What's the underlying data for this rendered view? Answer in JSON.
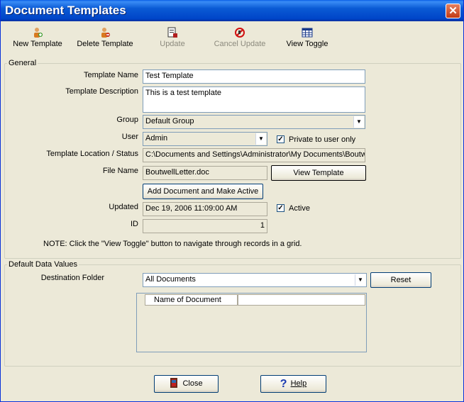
{
  "window": {
    "title": "Document Templates",
    "close_glyph": "✕"
  },
  "toolbar": [
    {
      "label": "New Template",
      "icon": "new-template-icon",
      "enabled": true
    },
    {
      "label": "Delete Template",
      "icon": "delete-template-icon",
      "enabled": true
    },
    {
      "label": "Update",
      "icon": "update-icon",
      "enabled": false
    },
    {
      "label": "Cancel Update",
      "icon": "cancel-update-icon",
      "enabled": false
    },
    {
      "label": "View Toggle",
      "icon": "view-toggle-icon",
      "enabled": true
    }
  ],
  "general": {
    "legend": "General",
    "template_name": {
      "label": "Template Name",
      "value": "Test Template"
    },
    "template_description": {
      "label": "Template Description",
      "value": "This is a test template"
    },
    "group": {
      "label": "Group",
      "value": "Default Group"
    },
    "user": {
      "label": "User",
      "value": "Admin"
    },
    "private": {
      "label": "Private to user only",
      "checked": true
    },
    "location": {
      "label": "Template Location / Status",
      "value": "C:\\Documents and Settings\\Administrator\\My Documents\\Boutwe"
    },
    "file_name": {
      "label": "File Name",
      "value": "BoutwellLetter.doc"
    },
    "view_template_button": "View Template",
    "add_document_button": "Add Document and Make Active",
    "updated": {
      "label": "Updated",
      "value": "Dec 19, 2006 11:09:00 AM"
    },
    "active": {
      "label": "Active",
      "checked": true
    },
    "id": {
      "label": "ID",
      "value": "1"
    },
    "note": "NOTE: Click the \"View Toggle\" button to navigate through records in a grid."
  },
  "defaults": {
    "legend": "Default Data Values",
    "destination_folder": {
      "label": "Destination Folder",
      "value": "All Documents"
    },
    "reset_button": "Reset",
    "grid": {
      "columns": [
        "Name of Document"
      ],
      "rows": []
    }
  },
  "footer": {
    "close_button": "Close",
    "help_button": "Help"
  },
  "colors": {
    "titlebar": "#0a5ad4",
    "window_bg": "#ece9d8"
  }
}
